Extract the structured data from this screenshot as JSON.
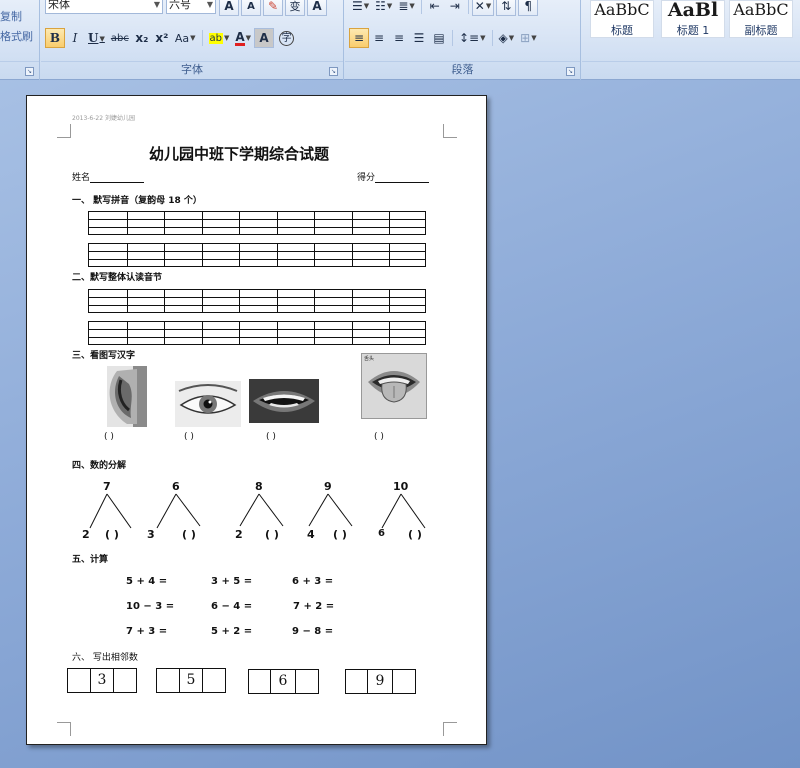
{
  "clipboard": {
    "copy_label": "复制",
    "format_painter_label": "格式刷"
  },
  "font_group": {
    "label": "字体",
    "font_name": "宋体",
    "font_size": "六号",
    "grow_label": "A",
    "shrink_label": "A",
    "bold": "B",
    "italic": "I",
    "underline": "U",
    "strike": "abc",
    "subscript": "x₂",
    "superscript": "x²",
    "change_case": "Aa",
    "highlight": "ab",
    "font_color": "A",
    "char_shading": "A",
    "enclose": "字",
    "text_effect": "A",
    "phonetic": "变"
  },
  "paragraph_group": {
    "label": "段落"
  },
  "styles_group": {
    "tiles": [
      {
        "sample": "AaBbC",
        "name": "标题"
      },
      {
        "sample": "AaBl",
        "name": "标题 1"
      },
      {
        "sample": "AaBbC",
        "name": "副标题"
      }
    ]
  },
  "colors": {
    "highlight_yellow": "#ffff00",
    "font_red": "#e02020",
    "active_button": "#f9cd6d"
  },
  "document": {
    "header_note": "2013-6-22 刘婕幼儿园",
    "title": "幼儿园中班下学期综合试题",
    "name_label": "姓名",
    "score_label": "得分",
    "section1": "一、   默写拼音（复韵母 18 个）",
    "section2": "二、默写整体认读音节",
    "section3": "三、看图写汉字",
    "section4": "四、数的分解",
    "section5": "五、计算",
    "section6": "六、  写出相邻数",
    "pictures": [
      {
        "name": "ear-picture",
        "paren": "(          )"
      },
      {
        "name": "eye-picture",
        "paren": "(          )"
      },
      {
        "name": "mouth-picture",
        "paren": "(          )"
      },
      {
        "name": "tongue-picture",
        "paren": "(          )",
        "caption": "舌头"
      }
    ],
    "trees": [
      {
        "top": "7",
        "left": "2",
        "right": "(    )"
      },
      {
        "top": "6",
        "left": "3",
        "right": "(    )"
      },
      {
        "top": "8",
        "left": "2",
        "right": "(    )"
      },
      {
        "top": "9",
        "left": "4",
        "right": "(    )"
      },
      {
        "top": "10",
        "left": "6",
        "right": "(    )"
      }
    ],
    "calculations": [
      [
        "5 + 4 =",
        "3 + 5 =",
        "6 + 3 ="
      ],
      [
        "10 − 3 =",
        "6 − 4 =",
        "7 + 2 ="
      ],
      [
        "7 + 3 =",
        "5 + 2 =",
        "9 − 8 ="
      ]
    ],
    "neighbors": [
      "3",
      "5",
      "6",
      "9"
    ]
  }
}
